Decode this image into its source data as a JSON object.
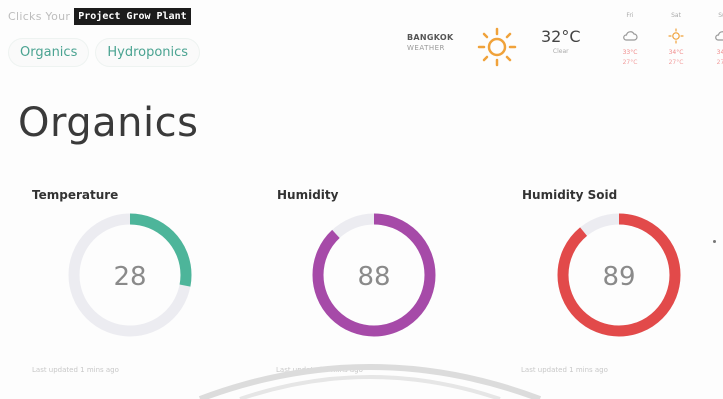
{
  "brand": {
    "prefix": "Clicks Your",
    "name": "Project Grow Plant"
  },
  "tabs": [
    {
      "label": "Organics"
    },
    {
      "label": "Hydroponics"
    }
  ],
  "weather": {
    "city": "BANGKOK",
    "subtitle": "WEATHER",
    "temperature": "32°C",
    "condition": "Clear",
    "icon": "sun-icon",
    "forecast": [
      {
        "day": "Fri",
        "icon": "cloud-icon",
        "high": "33°C",
        "low": "27°C"
      },
      {
        "day": "Sat",
        "icon": "sun-icon",
        "high": "34°C",
        "low": "27°C"
      },
      {
        "day": "Su",
        "icon": "cloud-icon",
        "high": "34°",
        "low": "27°"
      }
    ]
  },
  "page": {
    "title": "Organics"
  },
  "gauges": [
    {
      "title": "Temperature",
      "value": "28",
      "fraction": 0.28,
      "color": "#4db59a",
      "updated": "Last updated 1 mins ago"
    },
    {
      "title": "Humidity",
      "value": "88",
      "fraction": 0.88,
      "color": "#a64aa8",
      "updated": "Last updated 1 mins ago"
    },
    {
      "title": "Humidity Soid",
      "value": "89",
      "fraction": 0.89,
      "color": "#e24a4a",
      "updated": "Last updated 1 mins ago"
    }
  ],
  "colors": {
    "track": "#ececf1",
    "accent": "#4aa391"
  }
}
